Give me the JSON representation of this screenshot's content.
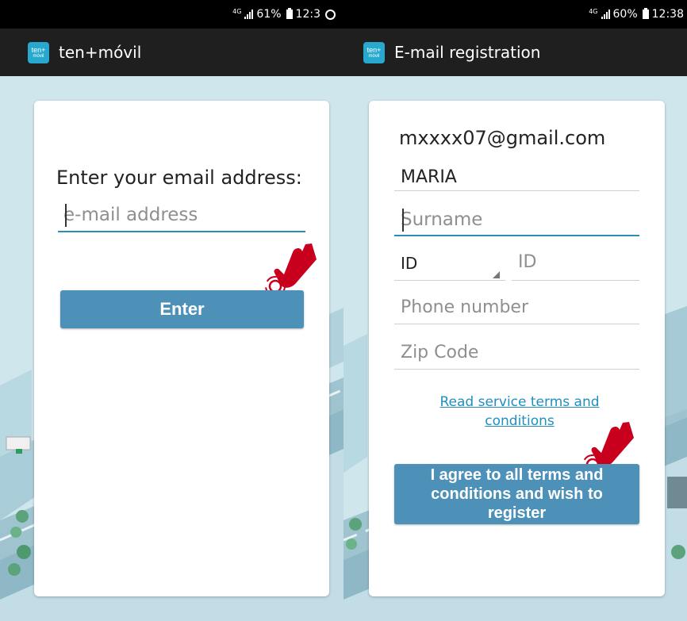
{
  "left_screen": {
    "status": {
      "network": "4G",
      "battery": "61%",
      "time": "12:3"
    },
    "appbar": {
      "logo_top": "ten+",
      "logo_bottom": "móvil",
      "title": "ten+móvil"
    },
    "form": {
      "prompt": "Enter your email address:",
      "email_placeholder": "e-mail address",
      "enter_button": "Enter"
    }
  },
  "right_screen": {
    "status": {
      "network": "4G",
      "battery": "60%",
      "time": "12:38"
    },
    "appbar": {
      "logo_top": "ten+",
      "logo_bottom": "móvil",
      "title": "E-mail registration"
    },
    "form": {
      "email": "mxxxx07@gmail.com",
      "name_value": "MARIA",
      "surname_placeholder": "Surname",
      "id_type_selected": "ID",
      "id_placeholder": "ID",
      "phone_placeholder": "Phone number",
      "zip_placeholder": "Zip Code",
      "terms_link": "Read service terms and conditions",
      "register_button": "I agree to all terms and conditions and wish to register"
    }
  },
  "icons": [
    "signal-icon",
    "battery-icon",
    "whatsapp-icon",
    "app-logo-icon",
    "tap-hand-icon"
  ],
  "colors": {
    "accent": "#4e91b8",
    "link": "#1f8fbf",
    "appbar": "#1f1f1f",
    "logo": "#27a9cf",
    "background": "#cfe6ec",
    "hand": "#c8001e"
  }
}
